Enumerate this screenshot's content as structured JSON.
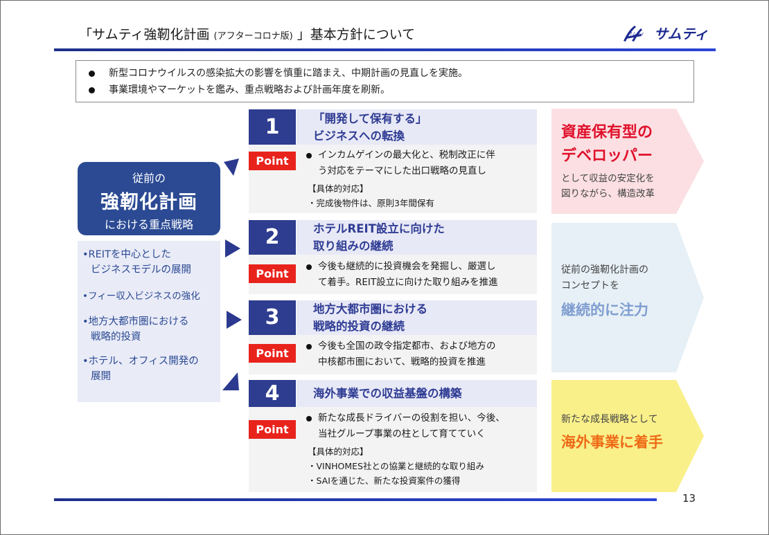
{
  "header": {
    "title_main": "「サムティ強靭化計画",
    "title_sub": "(アフターコロナ版)",
    "title_tail": "」基本方針について",
    "logo_text": "サムティ",
    "logo_mark_text": "サムティ"
  },
  "summary": [
    "新型コロナウイルスの感染拡大の影響を慎重に踏まえ、中期計画の見直しを実施。",
    "事業環境やマーケットを鑑み、重点戦略および計画年度を刷新。"
  ],
  "left": {
    "head_line1": "従前の",
    "head_line2": "強靭化計画",
    "head_line3": "における重点戦略",
    "items": [
      [
        "•REITを中心とした",
        "ビジネスモデルの展開"
      ],
      [
        "•フィー収入ビジネスの強化"
      ],
      [
        "•地方大都市圏における",
        "戦略的投資"
      ],
      [
        "•ホテル、オフィス開発の",
        "展開"
      ]
    ]
  },
  "point_label": "Point",
  "sections": [
    {
      "num": "1",
      "head": [
        "「開発して保有する」",
        "ビジネスへの転換"
      ],
      "bullet": [
        "インカムゲインの最大化と、税制改正に伴",
        "う対応をテーマにした出口戦略の見直し"
      ],
      "subs": [
        "【具体的対応】",
        "・完成後物件は、原則3年間保有"
      ]
    },
    {
      "num": "2",
      "head": [
        "ホテルREIT設立に向けた",
        "取り組みの継続"
      ],
      "bullet": [
        "今後も継続的に投資機会を発掘し、厳選し",
        "て着手。REIT設立に向けた取り組みを推進"
      ],
      "subs": []
    },
    {
      "num": "3",
      "head": [
        "地方大都市圏における",
        "戦略的投資の継続"
      ],
      "bullet": [
        "今後も全国の政令指定都市、および地方の",
        "中核都市圏において、戦略的投資を推進"
      ],
      "subs": []
    },
    {
      "num": "4",
      "head": [
        "海外事業での収益基盤の構築"
      ],
      "bullet": [
        "新たな成長ドライバーの役割を担い、今後、",
        "当社グループ事業の柱として育てていく"
      ],
      "subs": [
        "【具体的対応】",
        "・VINHOMES社との協業と継続的な取り組み",
        "・SAIを通じた、新たな投資案件の獲得"
      ]
    }
  ],
  "right": [
    {
      "big": [
        "資産保有型の",
        "デベロッパー"
      ],
      "small": [
        "として収益の安定化を",
        "図りながら、構造改革"
      ],
      "big_color": "#e0102a",
      "bg_color": "#fbdfe3"
    },
    {
      "small": [
        "従前の強靭化計画の",
        "コンセプトを"
      ],
      "big": [
        "継続的に注力"
      ],
      "big_color": "#7f9dd0",
      "bg_color": "#e6f0f6"
    },
    {
      "small": [
        "新たな成長戦略として"
      ],
      "big": [
        "海外事業に着手"
      ],
      "big_color": "#ee6a16",
      "bg_color": "#f9f08a"
    }
  ],
  "page_number": "13"
}
